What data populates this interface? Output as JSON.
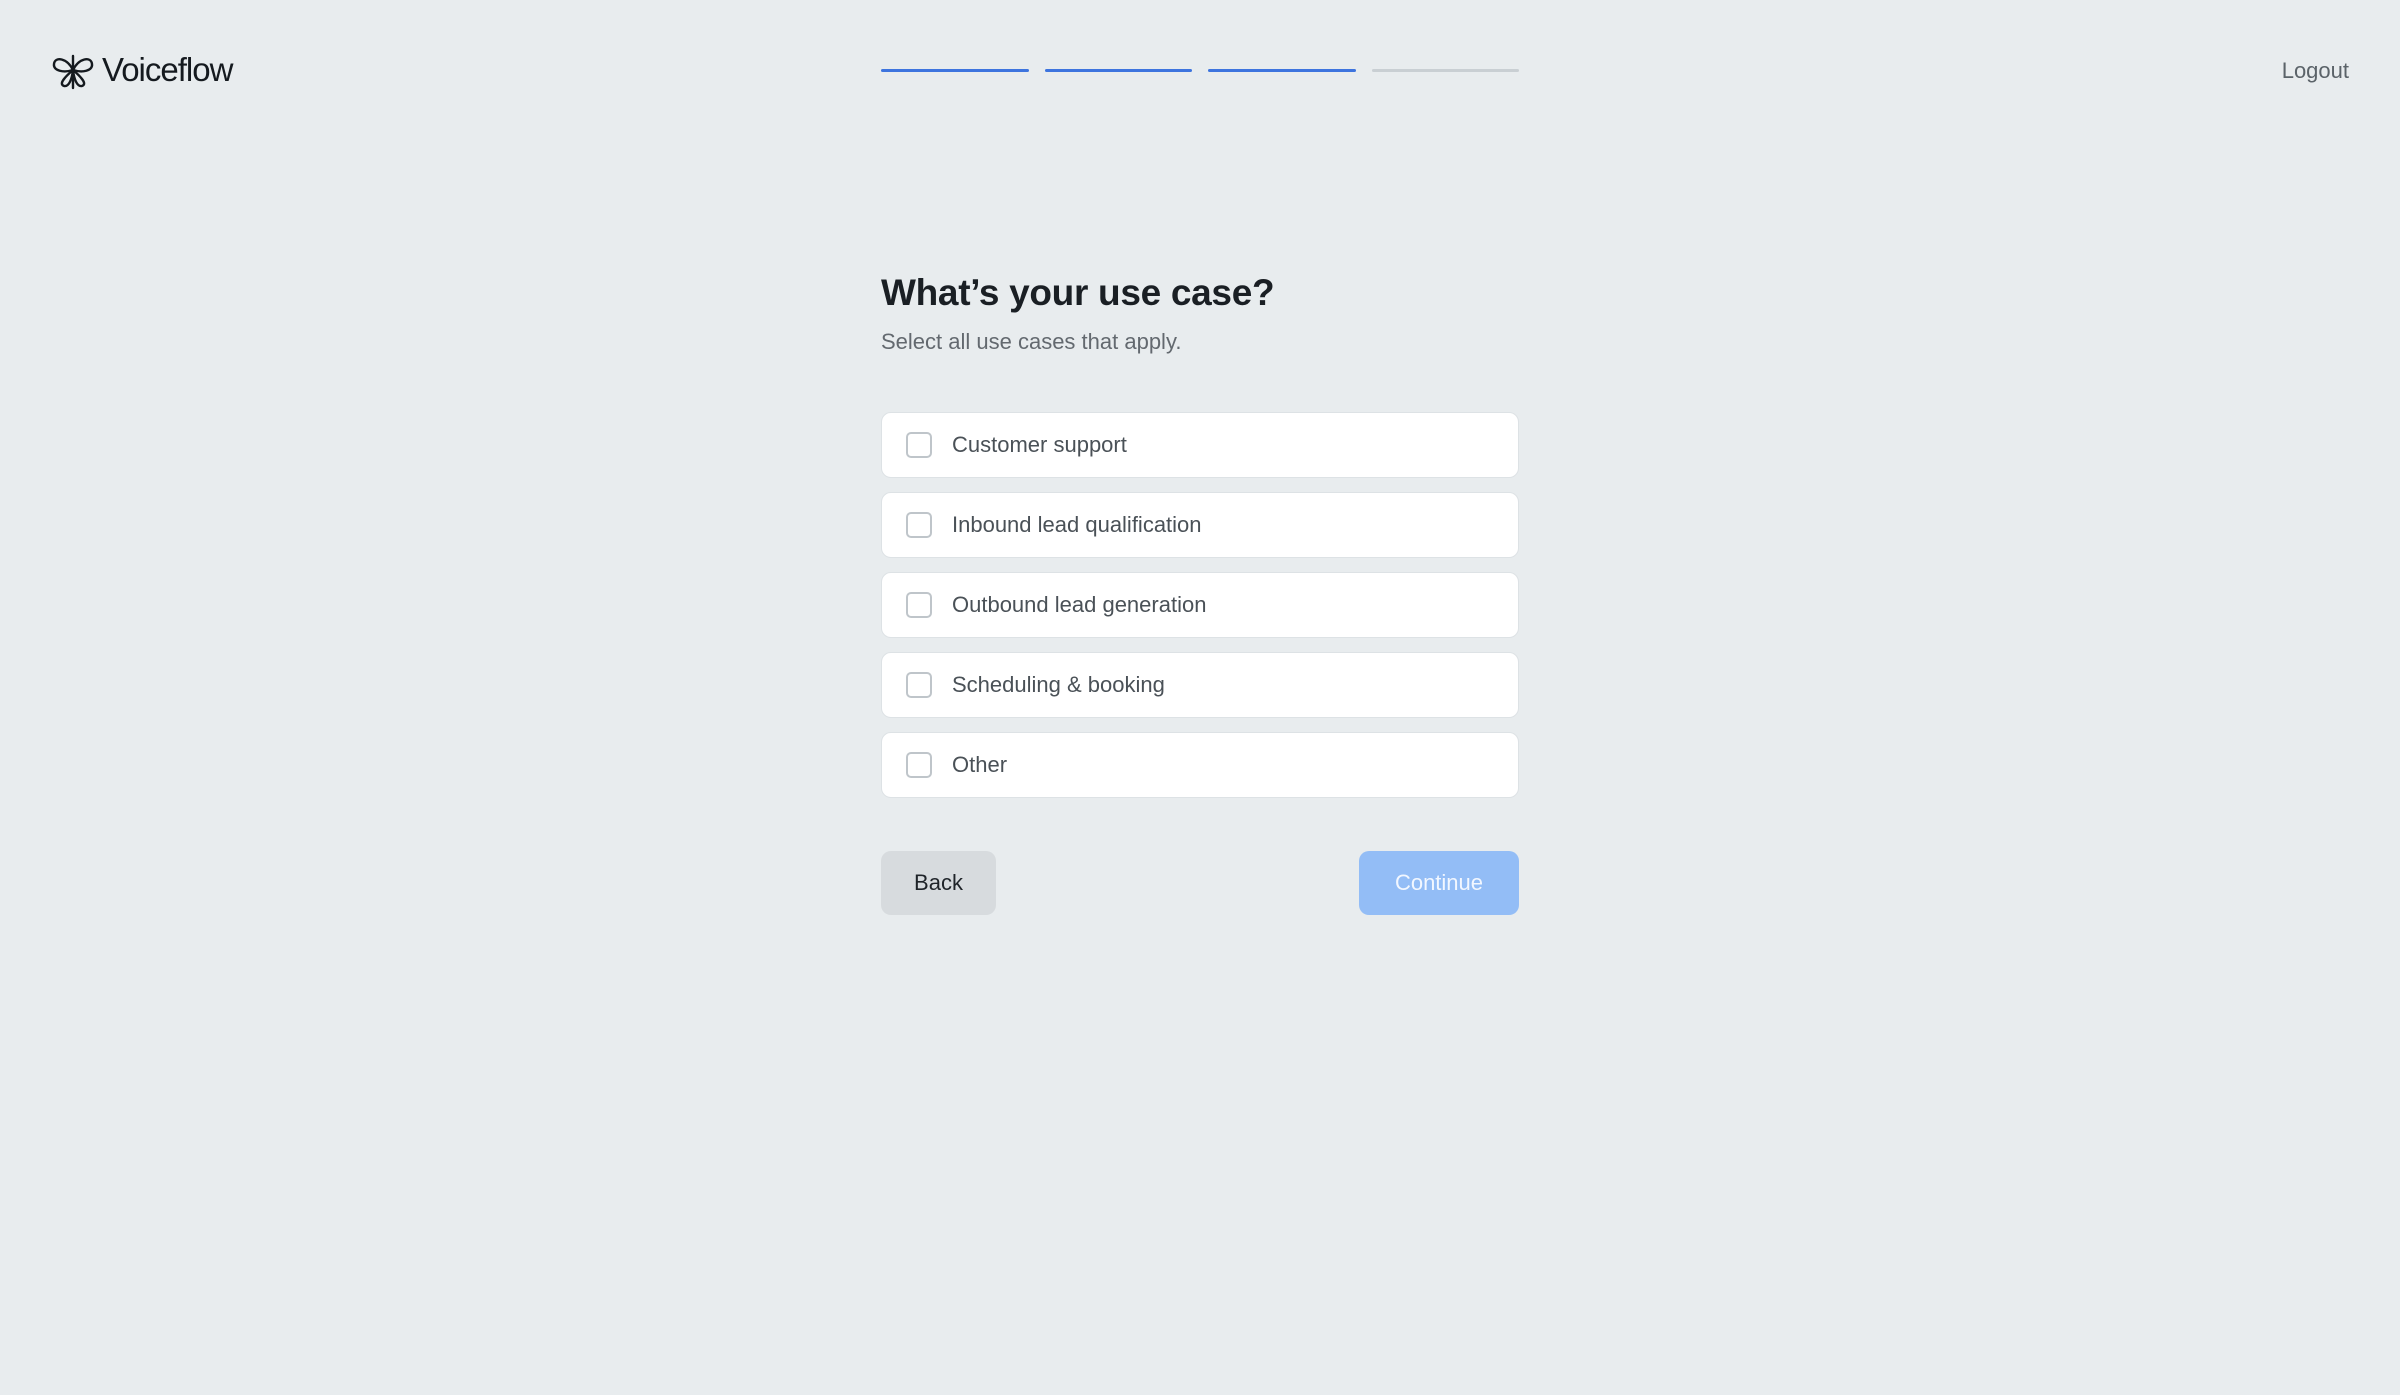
{
  "header": {
    "logo_text": "Voiceflow",
    "logout_label": "Logout",
    "progress": {
      "total_steps": 4,
      "completed_steps": 3
    }
  },
  "form": {
    "title": "What’s your use case?",
    "subtitle": "Select all use cases that apply.",
    "options": [
      {
        "label": "Customer support",
        "checked": false
      },
      {
        "label": "Inbound lead qualification",
        "checked": false
      },
      {
        "label": "Outbound lead generation",
        "checked": false
      },
      {
        "label": "Scheduling & booking",
        "checked": false
      },
      {
        "label": "Other",
        "checked": false
      }
    ],
    "back_label": "Back",
    "continue_label": "Continue"
  },
  "colors": {
    "background": "#e8ecee",
    "progress_done": "#3d74de",
    "progress_pending": "#c9cfd3",
    "continue_disabled": "#93bdf6"
  }
}
